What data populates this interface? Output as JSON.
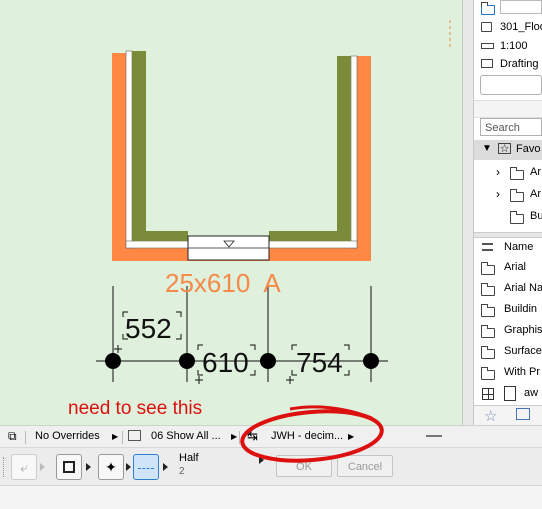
{
  "canvas": {
    "element_label": "25x610  A",
    "dimensions": [
      "552",
      "610",
      "754"
    ]
  },
  "annotation": {
    "text": "need to see this",
    "color": "#dd1010"
  },
  "side_panel": {
    "view_name": "301_Floo",
    "scale": "1:100",
    "layer_type": "Drafting",
    "search_placeholder": "Search",
    "favorites_label": "Favo",
    "tree_items": [
      "Ar",
      "Ar",
      "Bu"
    ],
    "name_header": "Name",
    "list_items": [
      "Arial",
      "Arial Na",
      "Buildin",
      "Graphis",
      "Surface",
      "With Pr",
      "aw"
    ]
  },
  "status_bar": {
    "override": "No Overrides",
    "show": "06 Show All ...",
    "dimension_standard": "JWH - decim..."
  },
  "toolbox": {
    "pen_weight_label": "Half",
    "pen_weight_value": "2",
    "ok_label": "OK",
    "cancel_label": "Cancel"
  },
  "colors": {
    "canvas_bg": "#dff0dc",
    "wall_outer": "#ff8844",
    "wall_inner": "#7a8c3a",
    "label_color": "#f58a4a"
  }
}
